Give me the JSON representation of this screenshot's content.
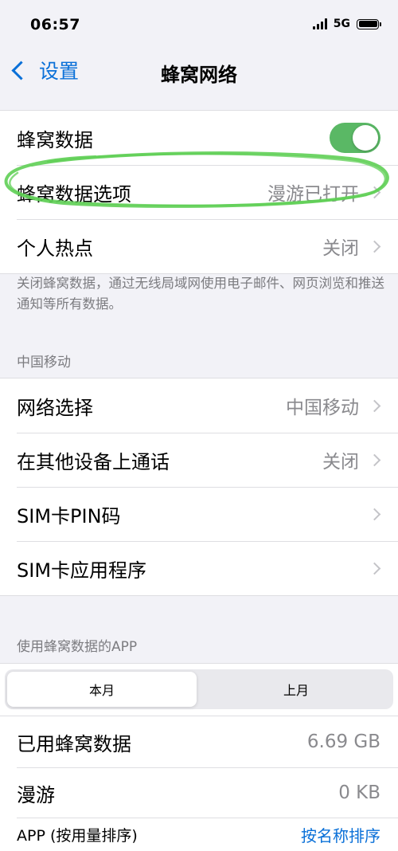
{
  "status_bar": {
    "time": "06:57",
    "network": "5G"
  },
  "nav": {
    "back_label": "设置",
    "title": "蜂窝网络"
  },
  "group1": {
    "cellular_data_label": "蜂窝数据",
    "cellular_data_on": true,
    "options_label": "蜂窝数据选项",
    "options_value": "漫游已打开",
    "hotspot_label": "个人热点",
    "hotspot_value": "关闭"
  },
  "footnote": "关闭蜂窝数据，通过无线局域网使用电子邮件、网页浏览和推送通知等所有数据。",
  "carrier_section": {
    "header": "中国移动",
    "network_selection_label": "网络选择",
    "network_selection_value": "中国移动",
    "calls_other_devices_label": "在其他设备上通话",
    "calls_other_devices_value": "关闭",
    "sim_pin_label": "SIM卡PIN码",
    "sim_apps_label": "SIM卡应用程序"
  },
  "usage_section": {
    "header": "使用蜂窝数据的APP",
    "segments": [
      "本月",
      "上月"
    ],
    "selected_segment": "本月",
    "used_data_label": "已用蜂窝数据",
    "used_data_value": "6.69 GB",
    "roaming_label": "漫游",
    "roaming_value": "0 KB",
    "apps_sort_label": "APP (按用量排序)",
    "sort_by_name_link": "按名称排序"
  },
  "colors": {
    "accent_blue": "#0a70d8",
    "toggle_green": "#5ab865",
    "annotation_green": "#5fcf55",
    "secondary_text": "#8a8a8e",
    "background": "#f2f2f7"
  }
}
